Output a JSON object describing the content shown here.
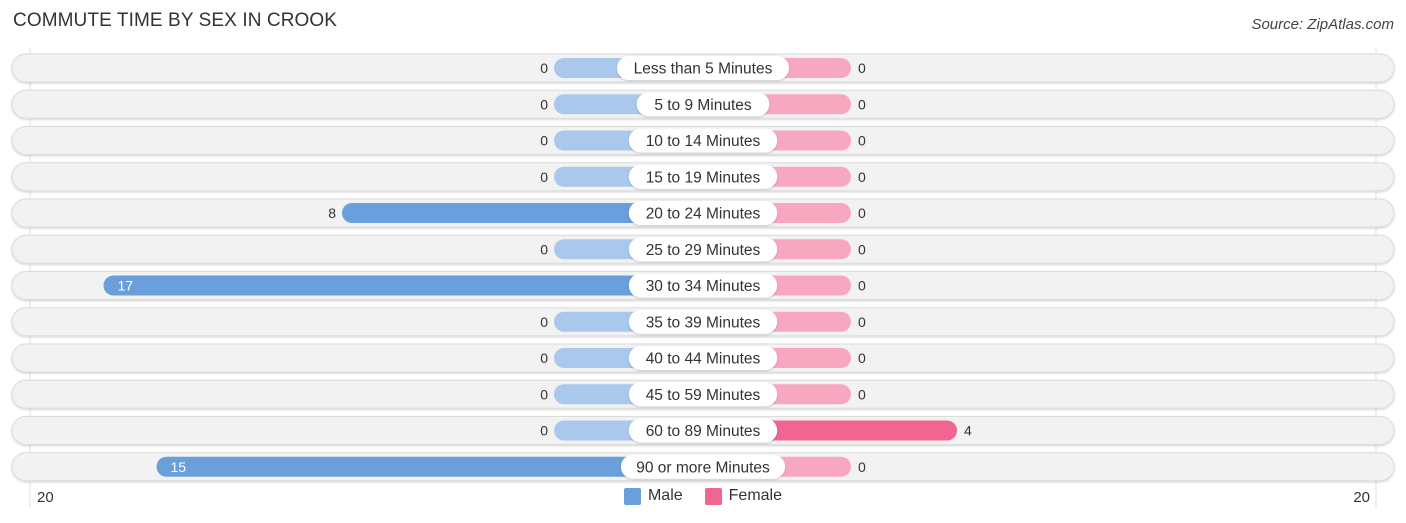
{
  "title": "COMMUTE TIME BY SEX IN CROOK",
  "source": "Source: ZipAtlas.com",
  "colors": {
    "male": "#6a9fdb",
    "male_light": "#aac8ec",
    "female": "#f06690",
    "female_light": "#f7a8c0",
    "row_bg": "#f2f2f2"
  },
  "legend": [
    {
      "label": "Male",
      "color": "#6a9fdb"
    },
    {
      "label": "Female",
      "color": "#f06690"
    }
  ],
  "axis": {
    "left_label": "20",
    "right_label": "20"
  },
  "chart_data": {
    "type": "bar",
    "orientation": "horizontal-diverging",
    "title": "COMMUTE TIME BY SEX IN CROOK",
    "categories": [
      "Less than 5 Minutes",
      "5 to 9 Minutes",
      "10 to 14 Minutes",
      "15 to 19 Minutes",
      "20 to 24 Minutes",
      "25 to 29 Minutes",
      "30 to 34 Minutes",
      "35 to 39 Minutes",
      "40 to 44 Minutes",
      "45 to 59 Minutes",
      "60 to 89 Minutes",
      "90 or more Minutes"
    ],
    "series": [
      {
        "name": "Male",
        "values": [
          0,
          0,
          0,
          0,
          8,
          0,
          17,
          0,
          0,
          0,
          0,
          15
        ]
      },
      {
        "name": "Female",
        "values": [
          0,
          0,
          0,
          0,
          0,
          0,
          0,
          0,
          0,
          0,
          4,
          0
        ]
      }
    ],
    "xlim": [
      -20,
      20
    ],
    "tick_labels": [
      "20",
      "20"
    ],
    "legend_position": "bottom-center",
    "grid": false
  }
}
